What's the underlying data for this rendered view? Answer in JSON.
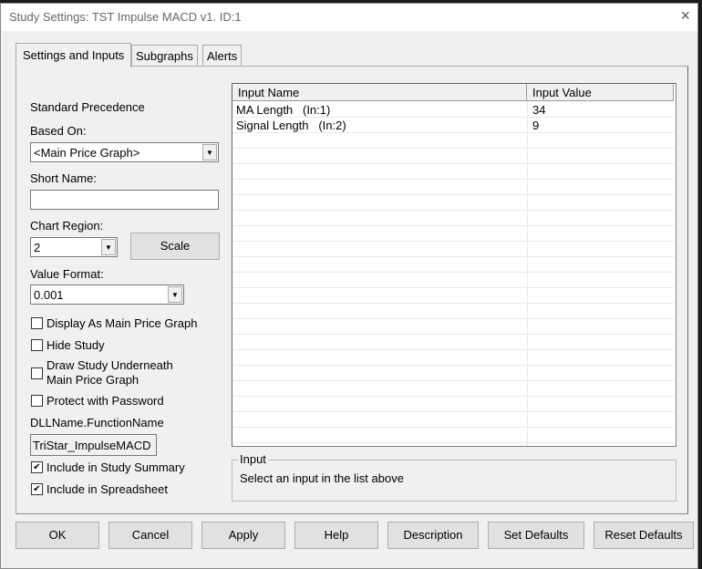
{
  "window": {
    "title": "Study Settings: TST Impulse MACD v1. ID:1",
    "close": "×"
  },
  "tabs": [
    "Settings and Inputs",
    "Subgraphs",
    "Alerts"
  ],
  "settings": {
    "standard_precedence": "Standard Precedence",
    "based_on_label": "Based On:",
    "based_on_value": "<Main Price Graph>",
    "short_name_label": "Short Name:",
    "short_name_value": "",
    "chart_region_label": "Chart Region:",
    "chart_region_value": "2",
    "scale_button": "Scale",
    "value_format_label": "Value Format:",
    "value_format_value": "0.001",
    "checkboxes": [
      {
        "label": "Display As Main Price Graph",
        "checked": false
      },
      {
        "label": "Hide Study",
        "checked": false
      },
      {
        "label": "Draw Study Underneath",
        "label2": "Main Price Graph",
        "checked": false
      },
      {
        "label": "Protect with Password",
        "checked": false
      }
    ],
    "dll_label": "DLLName.FunctionName",
    "dll_value": "TriStar_ImpulseMACD",
    "include_summary": {
      "label": "Include in Study Summary",
      "checked": true
    },
    "include_spreadsheet": {
      "label": "Include in Spreadsheet",
      "checked": true
    },
    "check_mark": "✔"
  },
  "inputs": {
    "headers": [
      "Input Name",
      "Input Value"
    ],
    "rows": [
      {
        "name": "MA Length   (In:1)",
        "value": "34"
      },
      {
        "name": "Signal Length   (In:2)",
        "value": "9"
      }
    ]
  },
  "input_group": {
    "title": "Input",
    "text": "Select an input in the list above"
  },
  "buttons": [
    "OK",
    "Cancel",
    "Apply",
    "Help",
    "Description",
    "Set Defaults",
    "Reset Defaults"
  ]
}
